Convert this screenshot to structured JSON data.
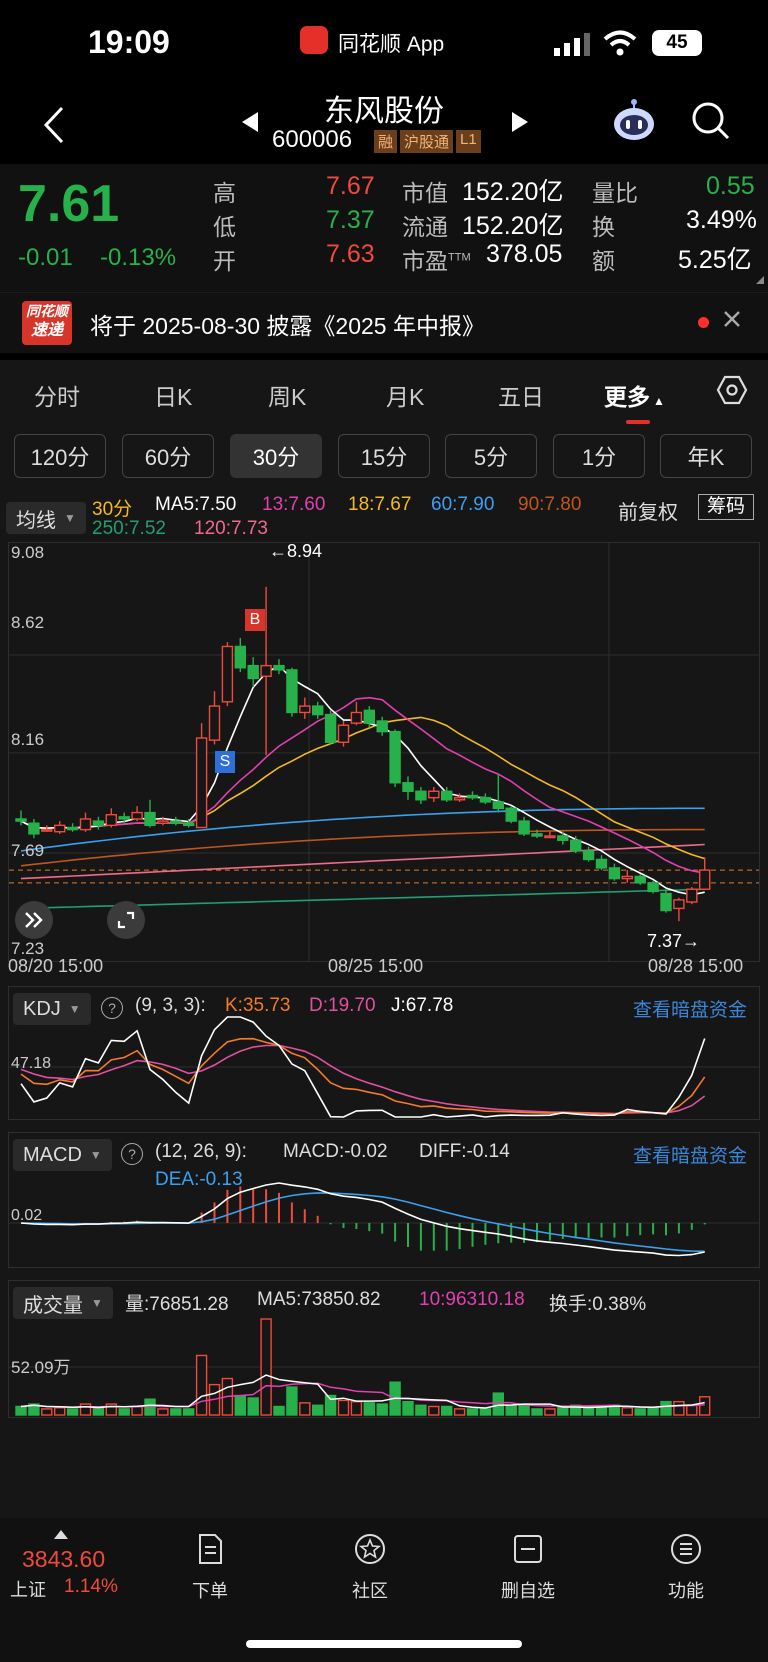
{
  "status_bar": {
    "time": "19:09",
    "app_name": "同花顺 App",
    "battery": "45"
  },
  "header": {
    "stock_name": "东风股份",
    "stock_code": "600006",
    "tags": [
      "融",
      "沪股通",
      "L1"
    ]
  },
  "quote": {
    "price": "7.61",
    "change": "-0.01",
    "change_pct": "-0.13%",
    "high_label": "高",
    "high": "7.67",
    "low_label": "低",
    "low": "7.37",
    "open_label": "开",
    "open": "7.63",
    "mktcap_label": "市值",
    "mktcap": "152.20亿",
    "float_label": "流通",
    "float": "152.20亿",
    "pe_label": "市盈",
    "pe_sup": "TTM",
    "pe": "378.05",
    "vr_label": "量比",
    "vr": "0.55",
    "turnover_label": "换",
    "turnover": "3.49%",
    "amount_label": "额",
    "amount": "5.25亿"
  },
  "news": {
    "logo_top": "同花顺",
    "logo_bottom": "速递",
    "text": "将于 2025-08-30 披露《2025 年中报》"
  },
  "tabs": [
    "分时",
    "日K",
    "周K",
    "月K",
    "五日",
    "更多"
  ],
  "periods": [
    "120分",
    "60分",
    "30分",
    "15分",
    "5分",
    "1分",
    "年K"
  ],
  "ma_header": {
    "selector": "均线",
    "period": "30分",
    "items": [
      {
        "text": "MA5:7.50",
        "color": "#ffffff"
      },
      {
        "text": "13:7.60",
        "color": "#e040b0"
      },
      {
        "text": "18:7.67",
        "color": "#f5b922"
      },
      {
        "text": "60:7.90",
        "color": "#3aa0f0"
      },
      {
        "text": "90:7.80",
        "color": "#c0561e"
      },
      {
        "text": "250:7.52",
        "color": "#20a070"
      },
      {
        "text": "120:7.73",
        "color": "#f06a8a"
      }
    ],
    "adjust_label": "前复权",
    "chip_label": "筹码"
  },
  "chart_data": [
    {
      "type": "candlestick",
      "title": "30分",
      "y_ticks": [
        "9.08",
        "8.62",
        "8.16",
        "7.69",
        "7.23"
      ],
      "x_labels": [
        "08/20 15:00",
        "08/25 15:00",
        "08/28 15:00"
      ],
      "ylim": [
        7.23,
        9.08
      ],
      "max_label": "←8.94",
      "min_label": "7.37→",
      "signals": [
        "B",
        "S"
      ],
      "candles": [
        [
          7.85,
          7.84,
          7.89,
          7.82
        ],
        [
          7.83,
          7.78,
          7.85,
          7.76
        ],
        [
          7.8,
          7.8,
          7.82,
          7.79
        ],
        [
          7.79,
          7.82,
          7.84,
          7.78
        ],
        [
          7.81,
          7.8,
          7.83,
          7.79
        ],
        [
          7.8,
          7.85,
          7.88,
          7.79
        ],
        [
          7.84,
          7.82,
          7.86,
          7.8
        ],
        [
          7.82,
          7.87,
          7.9,
          7.81
        ],
        [
          7.86,
          7.85,
          7.88,
          7.83
        ],
        [
          7.85,
          7.88,
          7.91,
          7.84
        ],
        [
          7.88,
          7.82,
          7.94,
          7.81
        ],
        [
          7.83,
          7.84,
          7.86,
          7.82
        ],
        [
          7.84,
          7.83,
          7.86,
          7.82
        ],
        [
          7.83,
          7.82,
          7.85,
          7.81
        ],
        [
          7.81,
          8.23,
          8.3,
          7.81
        ],
        [
          8.22,
          8.38,
          8.45,
          8.2
        ],
        [
          8.4,
          8.66,
          8.68,
          8.38
        ],
        [
          8.66,
          8.56,
          8.7,
          8.54
        ],
        [
          8.57,
          8.51,
          8.61,
          8.47
        ],
        [
          8.52,
          8.57,
          8.94,
          8.15
        ],
        [
          8.57,
          8.55,
          8.6,
          8.53
        ],
        [
          8.55,
          8.35,
          8.56,
          8.33
        ],
        [
          8.35,
          8.38,
          8.42,
          8.32
        ],
        [
          8.38,
          8.34,
          8.4,
          8.32
        ],
        [
          8.34,
          8.21,
          8.36,
          8.2
        ],
        [
          8.21,
          8.29,
          8.31,
          8.19
        ],
        [
          8.3,
          8.35,
          8.4,
          8.29
        ],
        [
          8.36,
          8.3,
          8.38,
          8.28
        ],
        [
          8.31,
          8.26,
          8.33,
          8.24
        ],
        [
          8.26,
          8.02,
          8.27,
          8.0
        ],
        [
          8.02,
          7.98,
          8.05,
          7.94
        ],
        [
          7.98,
          7.94,
          8.0,
          7.92
        ],
        [
          7.95,
          7.98,
          8.0,
          7.93
        ],
        [
          7.98,
          7.94,
          8.0,
          7.93
        ],
        [
          7.94,
          7.95,
          7.97,
          7.93
        ],
        [
          7.96,
          7.95,
          7.98,
          7.94
        ],
        [
          7.95,
          7.93,
          7.97,
          7.92
        ],
        [
          7.93,
          7.9,
          8.06,
          7.88
        ],
        [
          7.9,
          7.84,
          7.91,
          7.83
        ],
        [
          7.84,
          7.78,
          7.86,
          7.77
        ],
        [
          7.78,
          7.77,
          7.8,
          7.76
        ],
        [
          7.77,
          7.77,
          7.79,
          7.76
        ],
        [
          7.77,
          7.75,
          7.79,
          7.73
        ],
        [
          7.75,
          7.7,
          7.77,
          7.69
        ],
        [
          7.7,
          7.66,
          7.72,
          7.65
        ],
        [
          7.66,
          7.62,
          7.68,
          7.61
        ],
        [
          7.62,
          7.57,
          7.64,
          7.56
        ],
        [
          7.57,
          7.58,
          7.61,
          7.55
        ],
        [
          7.58,
          7.55,
          7.59,
          7.54
        ],
        [
          7.55,
          7.51,
          7.56,
          7.5
        ],
        [
          7.5,
          7.42,
          7.52,
          7.41
        ],
        [
          7.43,
          7.47,
          7.48,
          7.37
        ],
        [
          7.46,
          7.52,
          7.53,
          7.45
        ],
        [
          7.52,
          7.61,
          7.67,
          7.52
        ]
      ]
    },
    {
      "type": "line",
      "title": "KDJ",
      "params": "(9, 3, 3):",
      "y_tick": "47.18",
      "series": [
        {
          "name": "K:35.73",
          "color": "#f57a2a"
        },
        {
          "name": "D:19.70",
          "color": "#e050a0"
        },
        {
          "name": "J:67.78",
          "color": "#ffffff"
        }
      ]
    },
    {
      "type": "bar",
      "title": "MACD",
      "params": "(12, 26, 9):",
      "y_tick": "0.02",
      "series": [
        {
          "name": "MACD:-0.02",
          "color": "#dddddd"
        },
        {
          "name": "DIFF:-0.14",
          "color": "#dddddd"
        },
        {
          "name": "DEA:-0.13",
          "color": "#3aa0f0"
        }
      ]
    },
    {
      "type": "bar",
      "title": "成交量",
      "y_tick": "52.09万",
      "series": [
        {
          "name": "量:76851.28",
          "color": "#dddddd"
        },
        {
          "name": "MA5:73850.82",
          "color": "#dddddd"
        },
        {
          "name": "10:96310.18",
          "color": "#e040b0"
        },
        {
          "name": "换手:0.38%",
          "color": "#dddddd"
        }
      ]
    }
  ],
  "dark_pool_link": "查看暗盘资金",
  "bottom_bar": {
    "index_value": "3843.60",
    "index_name": "上证",
    "index_pct": "1.14%",
    "items": [
      "下单",
      "社区",
      "删自选",
      "功能"
    ]
  }
}
